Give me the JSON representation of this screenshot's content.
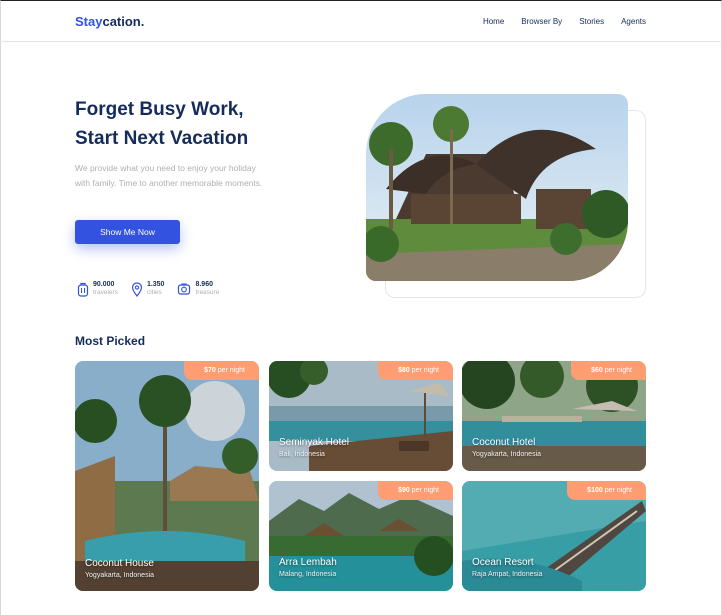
{
  "brand": {
    "first": "Stay",
    "second": "cation."
  },
  "nav": [
    "Home",
    "Browser By",
    "Stories",
    "Agents"
  ],
  "hero": {
    "title_line1": "Forget Busy Work,",
    "title_line2": "Start Next Vacation",
    "description": "We provide what you need to enjoy your holiday with family. Time to another memorable moments.",
    "cta": "Show Me Now",
    "stats": [
      {
        "value": "90.000",
        "label": "travelers",
        "icon": "traveler-icon"
      },
      {
        "value": "1.350",
        "label": "cities",
        "icon": "map-pin-icon"
      },
      {
        "value": "8.960",
        "label": "treasure",
        "icon": "camera-icon"
      }
    ]
  },
  "most_picked": {
    "title": "Most Picked",
    "per_night": "per night",
    "items": [
      {
        "price": "$70",
        "name": "Coconut House",
        "location": "Yogyakarta, Indonesia"
      },
      {
        "price": "$80",
        "name": "Seminyak Hotel",
        "location": "Bali, Indonesia"
      },
      {
        "price": "$60",
        "name": "Coconut Hotel",
        "location": "Yogyakarta, Indonesia"
      },
      {
        "price": "$90",
        "name": "Arra Lembah",
        "location": "Malang, Indonesia"
      },
      {
        "price": "$100",
        "name": "Ocean Resort",
        "location": "Raja Ampat, Indonesia"
      }
    ]
  },
  "colors": {
    "primary": "#3252DF",
    "navy": "#152C5B",
    "muted": "#B0B0B0",
    "badge": "#FF9D72"
  }
}
